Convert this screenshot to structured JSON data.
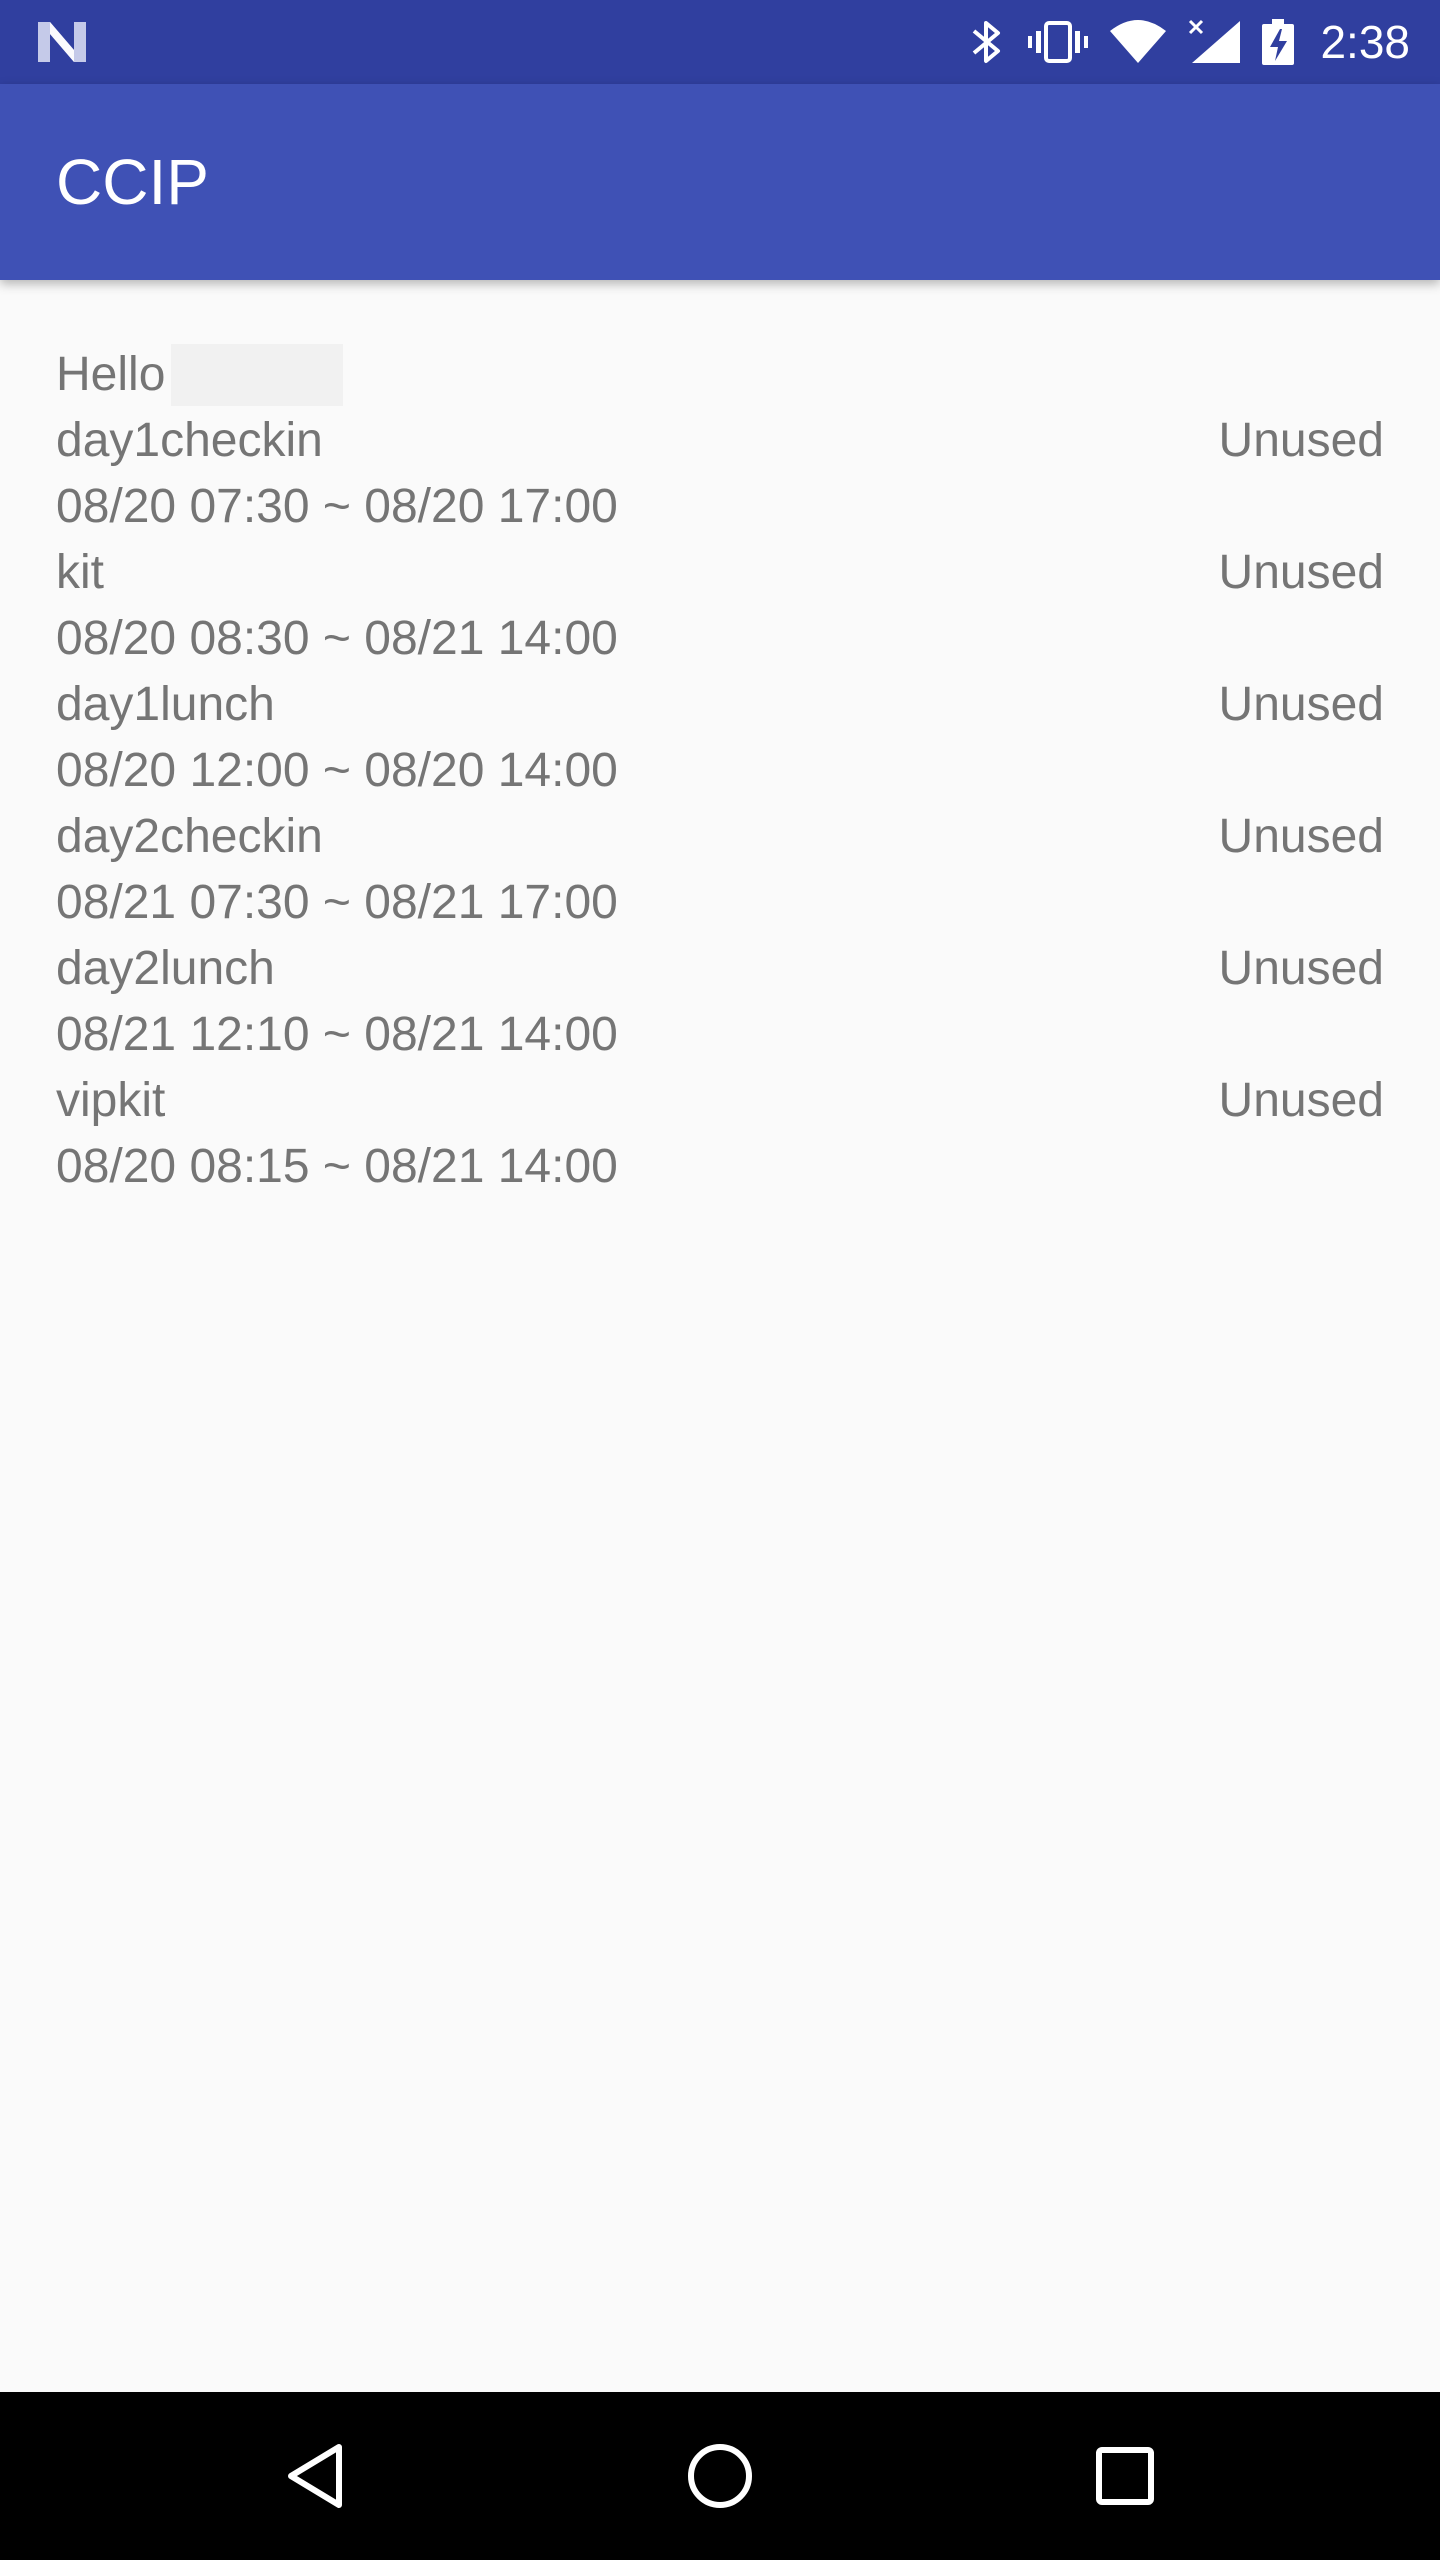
{
  "status_bar": {
    "time": "2:38",
    "icons": [
      "android-n-icon",
      "bluetooth-icon",
      "vibrate-icon",
      "wifi-icon",
      "cell-signal-icon",
      "battery-charging-icon"
    ]
  },
  "app_bar": {
    "title": "CCIP"
  },
  "greeting": {
    "text": "Hello"
  },
  "scenarios": [
    {
      "name": "day1checkin",
      "time_range": "08/20 07:30 ~ 08/20 17:00",
      "status": "Unused"
    },
    {
      "name": "kit",
      "time_range": "08/20 08:30 ~ 08/21 14:00",
      "status": "Unused"
    },
    {
      "name": "day1lunch",
      "time_range": "08/20 12:00 ~ 08/20 14:00",
      "status": "Unused"
    },
    {
      "name": "day2checkin",
      "time_range": "08/21 07:30 ~ 08/21 17:00",
      "status": "Unused"
    },
    {
      "name": "day2lunch",
      "time_range": "08/21 12:10 ~ 08/21 14:00",
      "status": "Unused"
    },
    {
      "name": "vipkit",
      "time_range": "08/20 08:15 ~ 08/21 14:00",
      "status": "Unused"
    }
  ],
  "nav_bar": {
    "buttons": [
      "back-icon",
      "home-icon",
      "recents-icon"
    ]
  },
  "colors": {
    "status_bar": "#303f9f",
    "app_bar": "#3f51b5",
    "background": "#fafafa",
    "text_secondary": "#757575",
    "nav_bar": "#000000"
  }
}
